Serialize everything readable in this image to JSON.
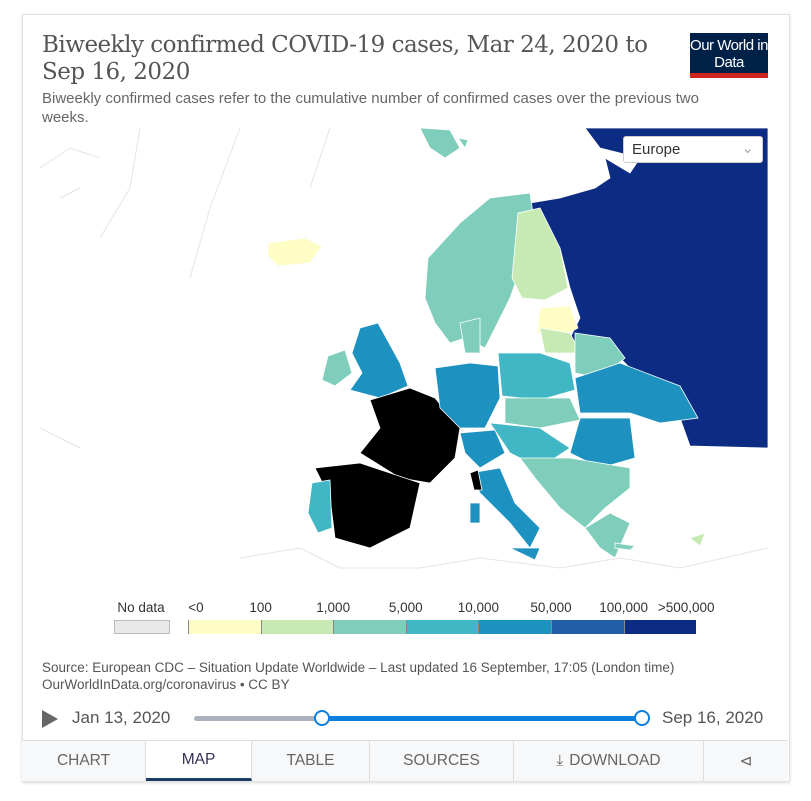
{
  "header": {
    "title": "Biweekly confirmed COVID-19 cases, Mar 24, 2020 to Sep 16, 2020",
    "subtitle": "Biweekly confirmed cases refer to the cumulative number of confirmed cases over the previous two weeks.",
    "logo": "Our World in Data"
  },
  "region_select": {
    "value": "Europe"
  },
  "legend": {
    "no_data_label": "No data",
    "no_data_color": "#e9e9e9",
    "labels": [
      "<0",
      "100",
      "1,000",
      "5,000",
      "10,000",
      "50,000",
      "100,000",
      ">500,000"
    ],
    "colors": [
      "#fefdc5",
      "#c7e9b4",
      "#7fcdbb",
      "#41b6c4",
      "#1d91c0",
      "#225ea8",
      "#0c2c84"
    ]
  },
  "footer": {
    "source": "Source: European CDC – Situation Update Worldwide – Last updated 16 September, 17:05 (London time)",
    "url": "OurWorldInData.org/coronavirus • CC BY"
  },
  "timeline": {
    "start": "Jan 13, 2020",
    "end": "Sep 16, 2020",
    "selected_start": "Mar 24, 2020",
    "selected_end": "Sep 16, 2020"
  },
  "tabs": [
    "CHART",
    "MAP",
    "TABLE",
    "SOURCES",
    "DOWNLOAD"
  ],
  "active_tab": "MAP"
}
